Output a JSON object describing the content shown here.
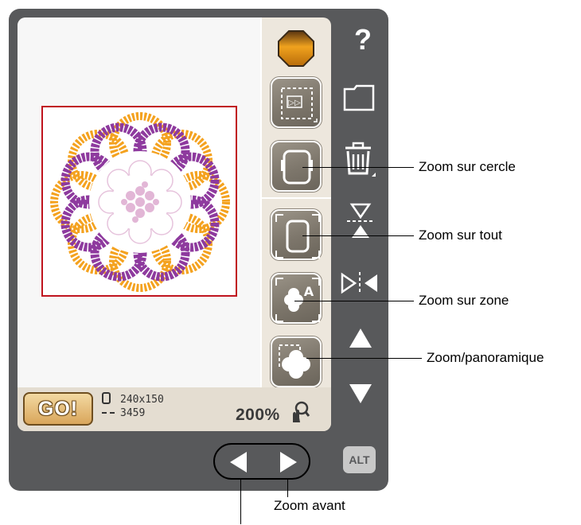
{
  "toolbar": {
    "help_label": "?",
    "alt_label": "ALT",
    "icons": [
      "help-icon",
      "folder-icon",
      "delete-icon",
      "flip-vertical-icon",
      "flip-horizontal-icon",
      "move-up-icon",
      "move-down-icon"
    ]
  },
  "status": {
    "go_label": "GO!",
    "size_text": "240x150",
    "stitch_text": "3459",
    "zoom_text": "200%"
  },
  "zoom_panel": {
    "buttons": [
      "zoom-to-hoop",
      "zoom-to-all",
      "zoom-to-area",
      "zoom-pan"
    ]
  },
  "callouts": {
    "zoom_hoop": "Zoom sur cercle",
    "zoom_all": "Zoom sur tout",
    "zoom_area": "Zoom sur zone",
    "zoom_pan": "Zoom/panoramique",
    "zoom_in": "Zoom avant"
  },
  "colors": {
    "frame": "#58595b",
    "hoop_outline": "#c0141e",
    "petal_purple": "#8e3a9e",
    "petal_orange": "#f4a21f",
    "center_pink": "#e2b6d6",
    "go_button": "#d9a65b"
  }
}
